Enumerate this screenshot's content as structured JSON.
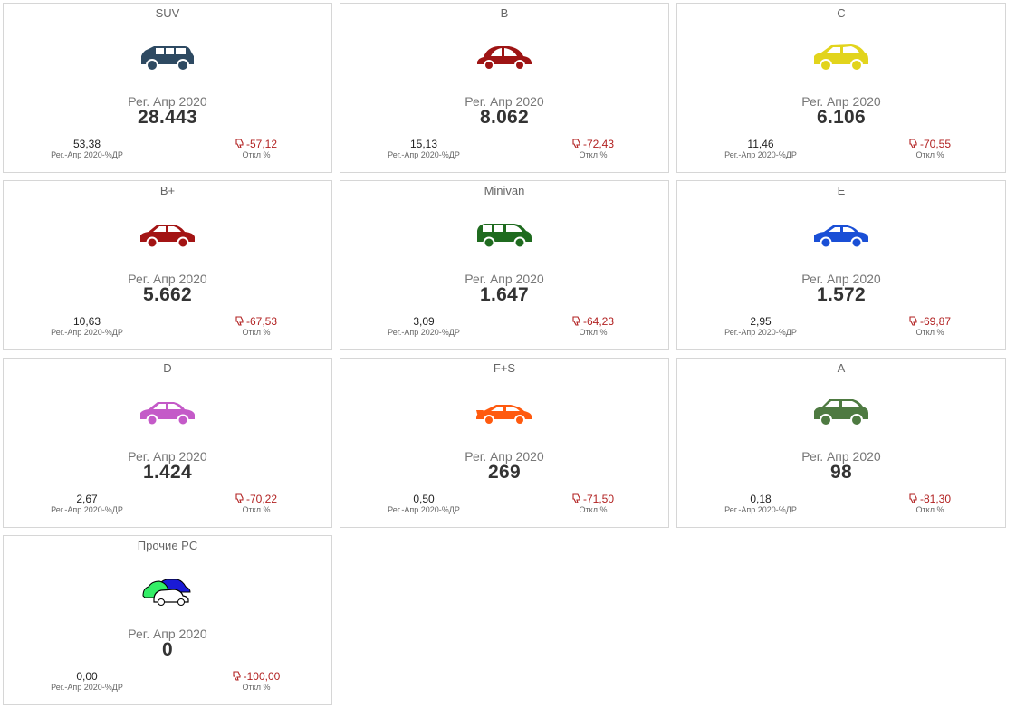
{
  "cards": [
    {
      "title": "SUV",
      "icon": "suv-car-icon",
      "color": "#2e4a62",
      "period": "Рег. Апр 2020",
      "value": "28.443",
      "share": "53,38",
      "share_label": "Рег.-Апр 2020-%ДР",
      "deviation": "-57,12",
      "deviation_label": "Откл %"
    },
    {
      "title": "B",
      "icon": "beetle-car-icon",
      "color": "#9e1414",
      "period": "Рег. Апр 2020",
      "value": "8.062",
      "share": "15,13",
      "share_label": "Рег.-Апр 2020-%ДР",
      "deviation": "-72,43",
      "deviation_label": "Откл %"
    },
    {
      "title": "C",
      "icon": "hatchback-car-icon",
      "color": "#e2d41c",
      "period": "Рег. Апр 2020",
      "value": "6.106",
      "share": "11,46",
      "share_label": "Рег.-Апр 2020-%ДР",
      "deviation": "-70,55",
      "deviation_label": "Откл %"
    },
    {
      "title": "B+",
      "icon": "sedan-car-icon",
      "color": "#a31414",
      "period": "Рег. Апр 2020",
      "value": "5.662",
      "share": "10,63",
      "share_label": "Рег.-Апр 2020-%ДР",
      "deviation": "-67,53",
      "deviation_label": "Откл %"
    },
    {
      "title": "Minivan",
      "icon": "minivan-car-icon",
      "color": "#1f6b1f",
      "period": "Рег. Апр 2020",
      "value": "1.647",
      "share": "3,09",
      "share_label": "Рег.-Апр 2020-%ДР",
      "deviation": "-64,23",
      "deviation_label": "Откл %"
    },
    {
      "title": "E",
      "icon": "coupe-car-icon",
      "color": "#1a4fd6",
      "period": "Рег. Апр 2020",
      "value": "1.572",
      "share": "2,95",
      "share_label": "Рег.-Апр 2020-%ДР",
      "deviation": "-69,87",
      "deviation_label": "Откл %"
    },
    {
      "title": "D",
      "icon": "sedan-car-icon",
      "color": "#c45ac8",
      "period": "Рег. Апр 2020",
      "value": "1.424",
      "share": "2,67",
      "share_label": "Рег.-Апр 2020-%ДР",
      "deviation": "-70,22",
      "deviation_label": "Откл %"
    },
    {
      "title": "F+S",
      "icon": "sports-car-icon",
      "color": "#ff5a0f",
      "period": "Рег. Апр 2020",
      "value": "269",
      "share": "0,50",
      "share_label": "Рег.-Апр 2020-%ДР",
      "deviation": "-71,50",
      "deviation_label": "Откл %"
    },
    {
      "title": "A",
      "icon": "compact-car-icon",
      "color": "#4e7a41",
      "period": "Рег. Апр 2020",
      "value": "98",
      "share": "0,18",
      "share_label": "Рег.-Апр 2020-%ДР",
      "deviation": "-81,30",
      "deviation_label": "Откл %"
    },
    {
      "title": "Прочие PC",
      "icon": "multiple-cars-icon",
      "color": "#1a1ad6",
      "period": "Рег. Апр 2020",
      "value": "0",
      "share": "0,00",
      "share_label": "Рег.-Апр 2020-%ДР",
      "deviation": "-100,00",
      "deviation_label": "Откл %"
    }
  ],
  "icons": {
    "thumbs_down": "thumbs-down-icon"
  },
  "colors": {
    "negative": "#b22222",
    "border": "#d6d6d6"
  }
}
